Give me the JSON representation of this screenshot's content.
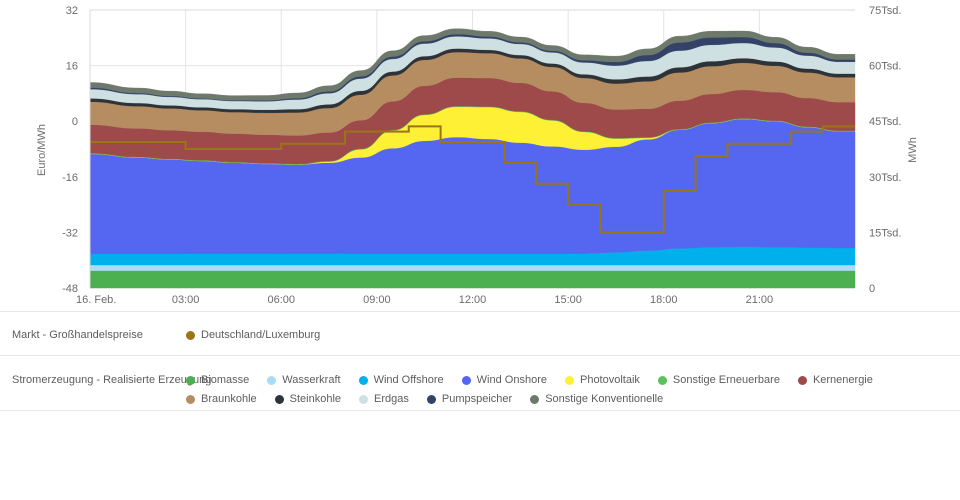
{
  "chart_data": {
    "type": "area",
    "title": "",
    "xlabel": "",
    "ylabel_left": "Euro/MWh",
    "ylabel_right": "MWh",
    "grid": true,
    "x_tick_labels": [
      "16. Feb.",
      "03:00",
      "06:00",
      "09:00",
      "12:00",
      "15:00",
      "18:00",
      "21:00"
    ],
    "x_tick_hours": [
      0,
      3,
      6,
      9,
      12,
      15,
      18,
      21
    ],
    "y_left_ticks": [
      32,
      16,
      0,
      -16,
      -32,
      -48
    ],
    "y_left_lim": [
      -48,
      32
    ],
    "y_right_ticks": [
      "75Tsd.",
      "60Tsd.",
      "45Tsd.",
      "30Tsd.",
      "15Tsd.",
      "0"
    ],
    "y_right_values": [
      75000,
      60000,
      45000,
      30000,
      15000,
      0
    ],
    "y_right_lim": [
      0,
      75000
    ],
    "hours": [
      0,
      1,
      2,
      3,
      4,
      5,
      6,
      7,
      8,
      9,
      10,
      11,
      12,
      13,
      14,
      15,
      16,
      17,
      18,
      19,
      20,
      21,
      22,
      23
    ],
    "series": [
      {
        "name": "Biomasse",
        "color": "#4caf50",
        "values": [
          4700,
          4700,
          4700,
          4700,
          4700,
          4700,
          4700,
          4700,
          4700,
          4700,
          4700,
          4700,
          4700,
          4700,
          4700,
          4700,
          4700,
          4700,
          4700,
          4700,
          4700,
          4700,
          4700,
          4700
        ]
      },
      {
        "name": "Wasserkraft",
        "color": "#aadcf5",
        "values": [
          1500,
          1500,
          1500,
          1500,
          1500,
          1500,
          1500,
          1500,
          1500,
          1500,
          1500,
          1500,
          1500,
          1500,
          1500,
          1500,
          1500,
          1500,
          1500,
          1500,
          1500,
          1500,
          1500,
          1500
        ]
      },
      {
        "name": "Wind Offshore",
        "color": "#00b0ec",
        "values": [
          3000,
          3000,
          3000,
          3100,
          3100,
          3100,
          3100,
          3100,
          3000,
          3000,
          3000,
          3000,
          3000,
          3000,
          3000,
          3100,
          3400,
          3900,
          4500,
          4800,
          4900,
          4800,
          4700,
          4600
        ]
      },
      {
        "name": "Wind Onshore",
        "color": "#5566f0",
        "values": [
          27000,
          26000,
          25500,
          25000,
          24500,
          24200,
          24000,
          24500,
          26000,
          28500,
          30500,
          31500,
          31000,
          30000,
          29000,
          28000,
          28500,
          30000,
          32000,
          33500,
          34500,
          34000,
          32500,
          31500
        ]
      },
      {
        "name": "Photovoltaik",
        "color": "#fdf035",
        "values": [
          0,
          0,
          0,
          0,
          0,
          0,
          0,
          300,
          2200,
          4800,
          7000,
          8200,
          8600,
          8300,
          7000,
          4800,
          2200,
          400,
          0,
          0,
          0,
          0,
          0,
          0
        ]
      },
      {
        "name": "Sonstige Erneuerbare",
        "color": "#5bc15b",
        "values": [
          150,
          150,
          150,
          150,
          150,
          150,
          150,
          150,
          150,
          150,
          150,
          150,
          150,
          150,
          150,
          150,
          150,
          150,
          150,
          150,
          150,
          150,
          150,
          150
        ]
      },
      {
        "name": "Kernenergie",
        "color": "#9e4a4a",
        "values": [
          7700,
          7700,
          7700,
          7700,
          7700,
          7700,
          7700,
          7700,
          7700,
          7700,
          7700,
          7700,
          7700,
          7700,
          7700,
          7700,
          7700,
          7700,
          7700,
          7700,
          7700,
          7700,
          7700,
          7700
        ]
      },
      {
        "name": "Braunkohle",
        "color": "#b58d61",
        "values": [
          6200,
          6000,
          5900,
          5800,
          5800,
          5900,
          6200,
          6600,
          6900,
          7000,
          7000,
          6900,
          6700,
          6600,
          6600,
          6700,
          7000,
          7400,
          7600,
          7500,
          7300,
          7100,
          6900,
          6700
        ]
      },
      {
        "name": "Steinkohle",
        "color": "#2e3338",
        "values": [
          900,
          850,
          820,
          800,
          800,
          830,
          900,
          1000,
          1050,
          1050,
          1000,
          950,
          900,
          900,
          920,
          1000,
          1150,
          1300,
          1400,
          1350,
          1250,
          1150,
          1050,
          980
        ]
      },
      {
        "name": "Erdgas",
        "color": "#cfe0e2",
        "values": [
          2500,
          2400,
          2300,
          2200,
          2200,
          2300,
          2600,
          3000,
          3300,
          3400,
          3400,
          3300,
          3100,
          3000,
          3000,
          3200,
          3700,
          4200,
          4500,
          4400,
          4100,
          3800,
          3500,
          3200
        ]
      },
      {
        "name": "Pumpspeicher",
        "color": "#344268",
        "values": [
          400,
          300,
          250,
          200,
          200,
          250,
          350,
          500,
          600,
          650,
          650,
          600,
          500,
          450,
          450,
          600,
          1000,
          1600,
          2200,
          2000,
          1600,
          1200,
          800,
          600
        ]
      },
      {
        "name": "Sonstige Konventionelle",
        "color": "#6d7a6b",
        "values": [
          1400,
          1350,
          1300,
          1250,
          1250,
          1300,
          1400,
          1500,
          1550,
          1550,
          1500,
          1450,
          1400,
          1400,
          1400,
          1450,
          1550,
          1650,
          1700,
          1680,
          1620,
          1550,
          1480,
          1420
        ]
      }
    ],
    "price_line": {
      "name": "Deutschland/Luxemburg",
      "color": "#9a7518",
      "unit": "Euro/MWh",
      "step": true,
      "values": [
        -6.0,
        -6.0,
        -6.0,
        -8.0,
        -8.0,
        -8.0,
        -6.5,
        -6.5,
        -3.0,
        -3.0,
        -1.5,
        -6.0,
        -6.0,
        -12.0,
        -18.0,
        -24.0,
        -32.0,
        -32.0,
        -20.0,
        -10.0,
        -6.5,
        -6.5,
        -3.0,
        -1.5
      ]
    }
  },
  "legend": {
    "market": {
      "title": "Markt - Großhandelspreise",
      "items": [
        {
          "label": "Deutschland/Luxemburg",
          "color": "#9a7518"
        }
      ]
    },
    "generation": {
      "title": "Stromerzeugung - Realisierte Erzeugung",
      "items": [
        {
          "label": "Biomasse",
          "color": "#4caf50"
        },
        {
          "label": "Wasserkraft",
          "color": "#aadcf5"
        },
        {
          "label": "Wind Offshore",
          "color": "#00b0ec"
        },
        {
          "label": "Wind Onshore",
          "color": "#5566f0"
        },
        {
          "label": "Photovoltaik",
          "color": "#fdf035"
        },
        {
          "label": "Sonstige Erneuerbare",
          "color": "#5bc15b"
        },
        {
          "label": "Kernenergie",
          "color": "#9e4a4a"
        },
        {
          "label": "Braunkohle",
          "color": "#b58d61"
        },
        {
          "label": "Steinkohle",
          "color": "#2e3338"
        },
        {
          "label": "Erdgas",
          "color": "#cfe0e2"
        },
        {
          "label": "Pumpspeicher",
          "color": "#344268"
        },
        {
          "label": "Sonstige Konventionelle",
          "color": "#6d7a6b"
        }
      ]
    }
  },
  "colors": {
    "grid": "#e4e4e4",
    "axis_text": "#6b6b6b",
    "separator": "#e6e6e6",
    "background": "#ffffff"
  }
}
